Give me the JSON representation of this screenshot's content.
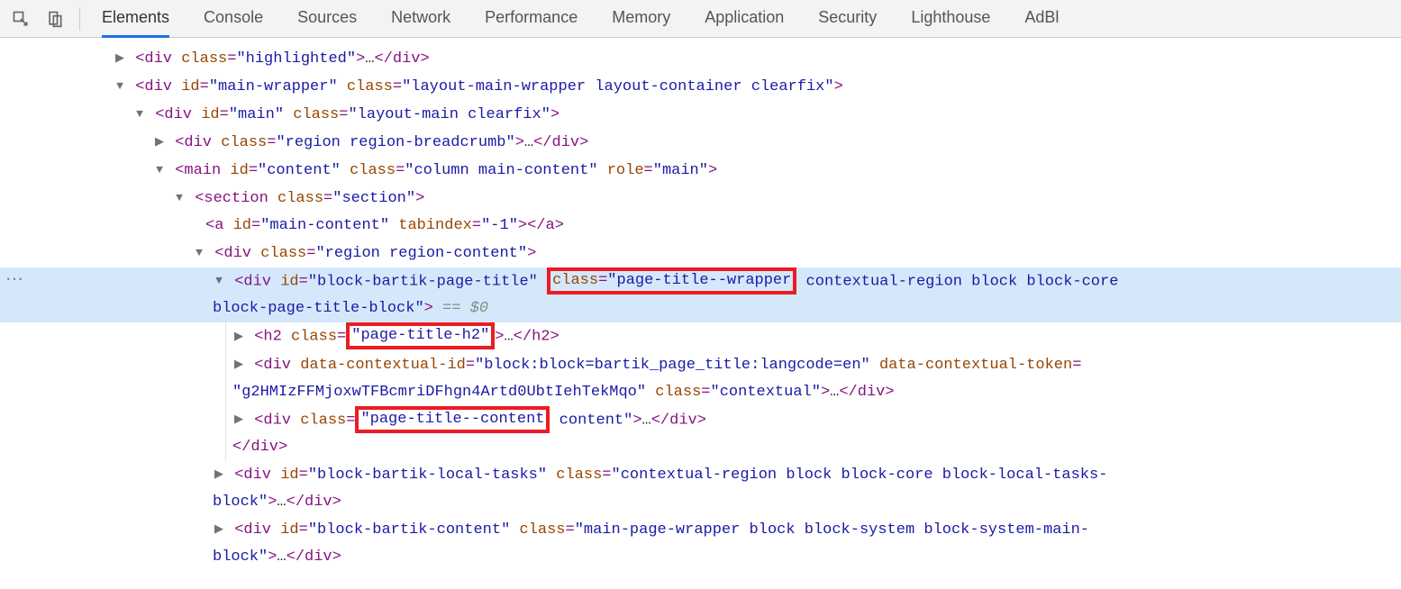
{
  "toolbar": {
    "tabs": [
      "Elements",
      "Console",
      "Sources",
      "Network",
      "Performance",
      "Memory",
      "Application",
      "Security",
      "Lighthouse",
      "AdBl"
    ]
  },
  "dom": {
    "l1": {
      "tag": "div",
      "attr_class": "class",
      "val_class": "highlighted",
      "ell": "…",
      "close": "</div>"
    },
    "l2": {
      "tag": "div",
      "attr_id": "id",
      "val_id": "main-wrapper",
      "attr_class": "class",
      "val_class": "layout-main-wrapper layout-container clearfix",
      "end": ">"
    },
    "l3": {
      "tag": "div",
      "attr_id": "id",
      "val_id": "main",
      "attr_class": "class",
      "val_class": "layout-main clearfix",
      "end": ">"
    },
    "l4": {
      "tag": "div",
      "attr_class": "class",
      "val_class": "region region-breadcrumb",
      "end": ">",
      "ell": "…",
      "close": "</div>"
    },
    "l5": {
      "tag": "main",
      "attr_id": "id",
      "val_id": "content",
      "attr_class": "class",
      "val_class": "column main-content",
      "attr_role": "role",
      "val_role": "main",
      "end": ">"
    },
    "l6": {
      "tag": "section",
      "attr_class": "class",
      "val_class": "section",
      "end": ">"
    },
    "l7": {
      "tag": "a",
      "attr_id": "id",
      "val_id": "main-content",
      "attr_tab": "tabindex",
      "val_tab": "-1",
      "end": ">",
      "close": "</a>"
    },
    "l8": {
      "tag": "div",
      "attr_class": "class",
      "val_class": "region region-content",
      "end": ">"
    },
    "l9a": {
      "tag": "div",
      "attr_id": "id",
      "val_id": "block-bartik-page-title",
      "attr_class": "class",
      "hl": "page-title--wrapper",
      "rest": "contextual-region block block-core"
    },
    "l9b": {
      "cont": "block-page-title-block",
      "end": ">",
      "annot": " == $0"
    },
    "l10": {
      "tag": "h2",
      "attr_class": "class",
      "hl": "page-title-h2",
      "end": ">",
      "ell": "…",
      "close": "</h2>"
    },
    "l11a": {
      "tag": "div",
      "attr1": "data-contextual-id",
      "val1": "block:block=bartik_page_title:langcode=en",
      "attr2": "data-contextual-token",
      "eq": "="
    },
    "l11b": {
      "val2": "g2HMIzFFMjoxwTFBcmriDFhgn4Artd0UbtIehTekMqo",
      "attr_class": "class",
      "val_class": "contextual",
      "end": ">",
      "ell": "…",
      "close": "</div>"
    },
    "l12": {
      "tag": "div",
      "attr_class": "class",
      "hl": "page-title--content",
      "rest": " content",
      "end": ">",
      "ell": "…",
      "close": "</div>"
    },
    "l13": {
      "close": "</div>"
    },
    "l14a": {
      "tag": "div",
      "attr_id": "id",
      "val_id": "block-bartik-local-tasks",
      "attr_class": "class",
      "val_class": "contextual-region block block-core block-local-tasks-"
    },
    "l14b": {
      "cont": "block",
      "end": ">",
      "ell": "…",
      "close": "</div>"
    },
    "l15a": {
      "tag": "div",
      "attr_id": "id",
      "val_id": "block-bartik-content",
      "attr_class": "class",
      "val_class": "main-page-wrapper block block-system block-system-main-"
    },
    "l15b": {
      "cont": "block",
      "end": ">",
      "ell": "…",
      "close": "</div>"
    }
  }
}
